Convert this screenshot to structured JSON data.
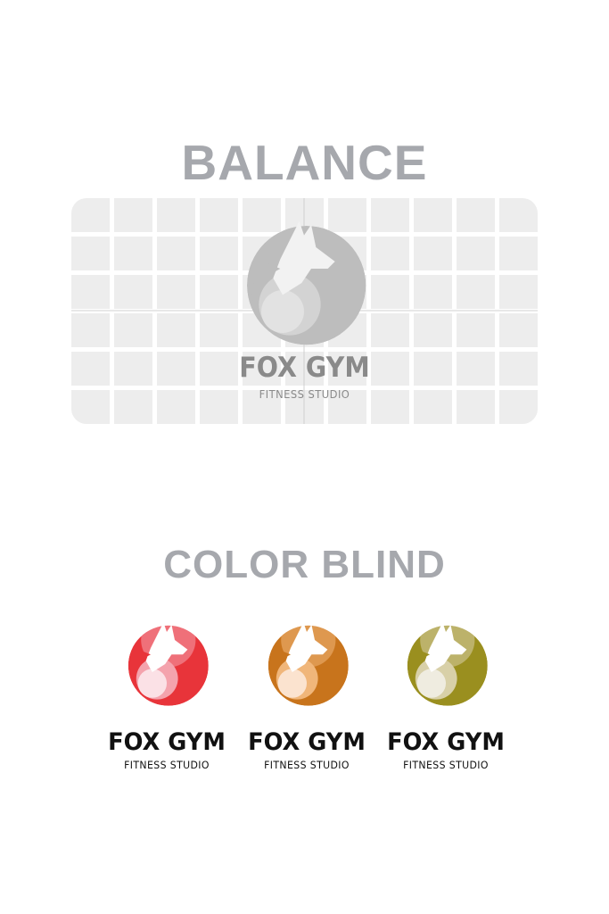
{
  "balance": {
    "title": "BALANCE",
    "brand_name": "FOX GYM",
    "brand_tagline": "FITNESS STUDIO"
  },
  "color_blind": {
    "title": "COLOR BLIND",
    "variants": [
      {
        "brand_name": "FOX GYM",
        "brand_tagline": "FITNESS STUDIO",
        "colors": {
          "main": "#e8343a",
          "light": "#f4a3ad",
          "pale": "#fbe1e6"
        }
      },
      {
        "brand_name": "FOX GYM",
        "brand_tagline": "FITNESS STUDIO",
        "colors": {
          "main": "#c8741c",
          "light": "#f0b67a",
          "pale": "#fbe3cf"
        }
      },
      {
        "brand_name": "FOX GYM",
        "brand_tagline": "FITNESS STUDIO",
        "colors": {
          "main": "#9a8f1f",
          "light": "#d8d0a8",
          "pale": "#efece0"
        }
      }
    ]
  },
  "colors": {
    "title_gray": "#a6a8ad",
    "grid_cell": "#ededed",
    "balance_logo": "#b5b5b5"
  }
}
